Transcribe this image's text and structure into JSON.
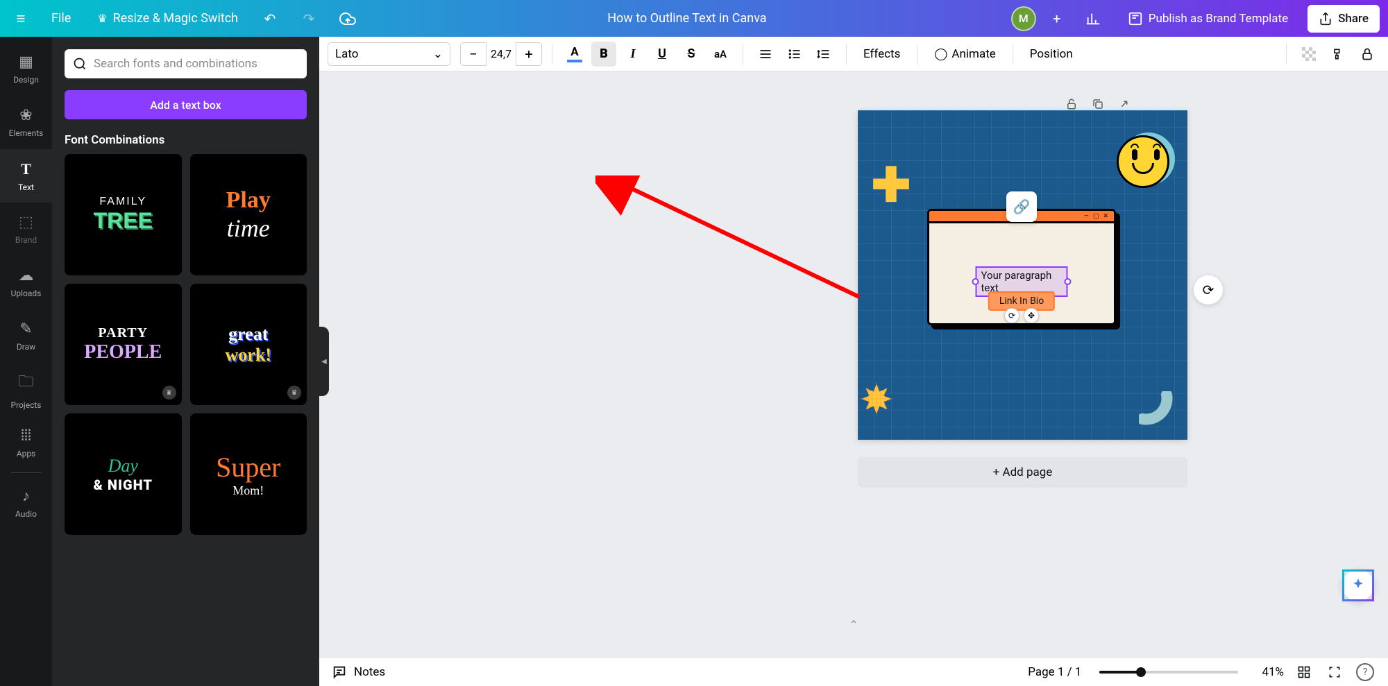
{
  "header": {
    "file": "File",
    "resize": "Resize & Magic Switch",
    "doc_title": "How to Outline Text in Canva",
    "avatar_letter": "M",
    "publish": "Publish as Brand Template",
    "share": "Share"
  },
  "rail": {
    "design": "Design",
    "elements": "Elements",
    "text": "Text",
    "brand": "Brand",
    "uploads": "Uploads",
    "draw": "Draw",
    "projects": "Projects",
    "apps": "Apps",
    "audio": "Audio"
  },
  "panel": {
    "search_placeholder": "Search fonts and combinations",
    "add_text": "Add a text box",
    "section": "Font Combinations",
    "cards": {
      "c1a": "FAMILY",
      "c1b": "TREE",
      "c2a": "Play",
      "c2b": "time",
      "c3a": "PARTY",
      "c3b": "PEOPLE",
      "c4a": "great",
      "c4b": "work!",
      "c5a": "Day",
      "c5b": "& NIGHT",
      "c6a": "Super",
      "c6b": "Mom!"
    }
  },
  "toolbar": {
    "font": "Lato",
    "size": "24,7",
    "effects": "Effects",
    "animate": "Animate",
    "position": "Position"
  },
  "canvas": {
    "text_selected": "Your paragraph text",
    "link_bio": "Link In Bio",
    "add_page": "+ Add page"
  },
  "footer": {
    "notes": "Notes",
    "page": "Page 1 / 1",
    "zoom": "41%"
  }
}
